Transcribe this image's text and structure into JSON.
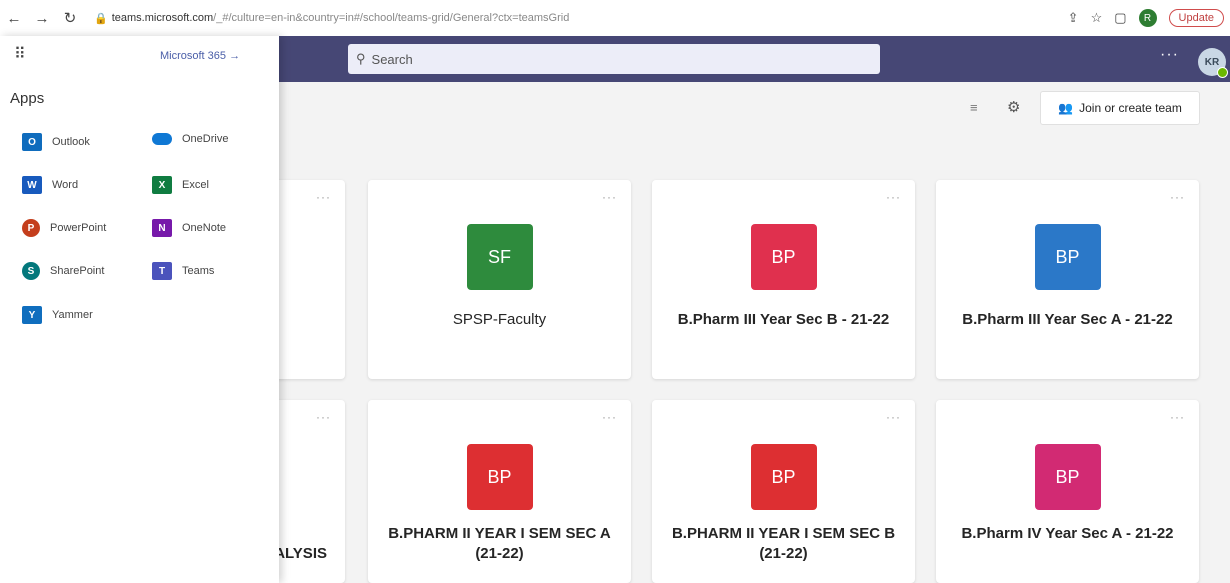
{
  "browser": {
    "url_host": "teams.microsoft.com",
    "url_path": "/_#/culture=en-in&country=in#/school/teams-grid/General?ctx=teamsGrid",
    "profile_initial": "R",
    "update_label": "Update"
  },
  "header": {
    "search_placeholder": "Search",
    "avatar_initials": "KR"
  },
  "toolbar": {
    "join_label": "Join or create team"
  },
  "launcher": {
    "microsoft365_label": "Microsoft 365 →",
    "apps_heading": "Apps",
    "apps": [
      {
        "name": "Outlook",
        "letter": "O",
        "color": "#0f6cbd"
      },
      {
        "name": "OneDrive",
        "letter": "",
        "color": "#0f78d4"
      },
      {
        "name": "Word",
        "letter": "W",
        "color": "#185abd"
      },
      {
        "name": "Excel",
        "letter": "X",
        "color": "#107c41"
      },
      {
        "name": "PowerPoint",
        "letter": "P",
        "color": "#c43e1c"
      },
      {
        "name": "OneNote",
        "letter": "N",
        "color": "#7719aa"
      },
      {
        "name": "SharePoint",
        "letter": "S",
        "color": "#03787c"
      },
      {
        "name": "Teams",
        "letter": "T",
        "color": "#4b53bc"
      },
      {
        "name": "Yammer",
        "letter": "Y",
        "color": "#106ebe"
      }
    ]
  },
  "teams": [
    {
      "initials": "SF",
      "name": "SPSP-Faculty",
      "color": "#2e8b3d"
    },
    {
      "initials": "BP",
      "name": "B.Pharm III Year Sec B - 21-22",
      "color": "#e0304e"
    },
    {
      "initials": "BP",
      "name": "B.Pharm III Year Sec A - 21-22",
      "color": "#2b78c8"
    },
    {
      "initials": "BP",
      "name": "B.PHARM II YEAR I SEM SEC A (21-22)",
      "color": "#dd2f32"
    },
    {
      "initials": "BP",
      "name": "B.PHARM II YEAR I SEM SEC B (21-22)",
      "color": "#dd2f32"
    },
    {
      "initials": "BP",
      "name": "B.Pharm IV Year Sec A - 21-22",
      "color": "#d22a73"
    }
  ],
  "partial_card_text": "ALYSIS",
  "more_label": "···"
}
